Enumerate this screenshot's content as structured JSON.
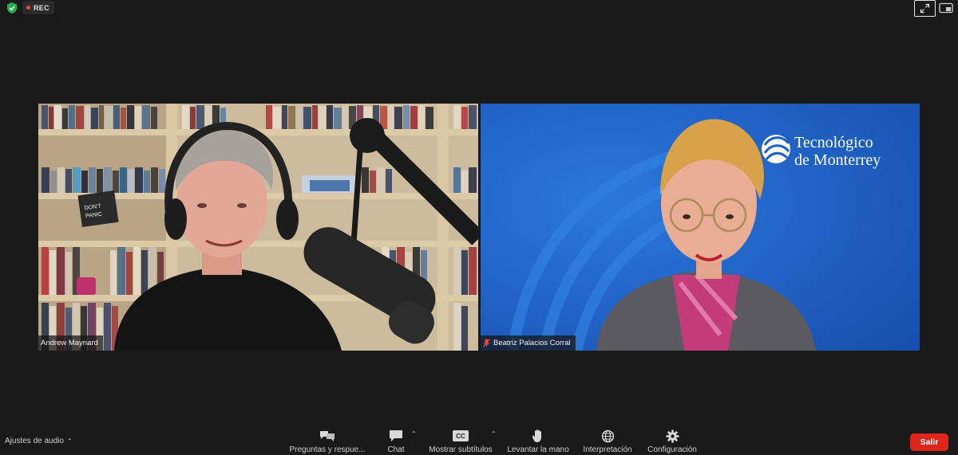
{
  "topbar": {
    "rec_label": "REC",
    "shield_icon": "shield-check-icon",
    "fullscreen_icon": "expand-arrows-icon",
    "view_icon": "gallery-view-icon"
  },
  "participants": [
    {
      "name": "Andrew Maynard",
      "muted": false
    },
    {
      "name": "Beatriz Palacios Corral",
      "muted": true,
      "background_brand": "Tecnológico de Monterrey"
    }
  ],
  "brand": {
    "line1": "Tecnológico",
    "line2": "de Monterrey"
  },
  "toolbar": {
    "audio_settings": "Ajustes de audio",
    "items": [
      {
        "label": "Preguntas y respue...",
        "icon": "qa-bubbles-icon"
      },
      {
        "label": "Chat",
        "icon": "chat-bubble-icon"
      },
      {
        "label": "Mostrar subtítulos",
        "icon": "cc-icon",
        "icon_text": "CC"
      },
      {
        "label": "Levantar la mano",
        "icon": "raise-hand-icon"
      },
      {
        "label": "Interpretación",
        "icon": "globe-icon"
      },
      {
        "label": "Configuración",
        "icon": "gear-icon"
      }
    ],
    "leave_label": "Salir"
  },
  "colors": {
    "background": "#1a1a1a",
    "leave_button": "#e0251b",
    "rec_dot": "#e84c3d",
    "shield": "#22b04b",
    "brand_blue": "#1b5fc6"
  }
}
